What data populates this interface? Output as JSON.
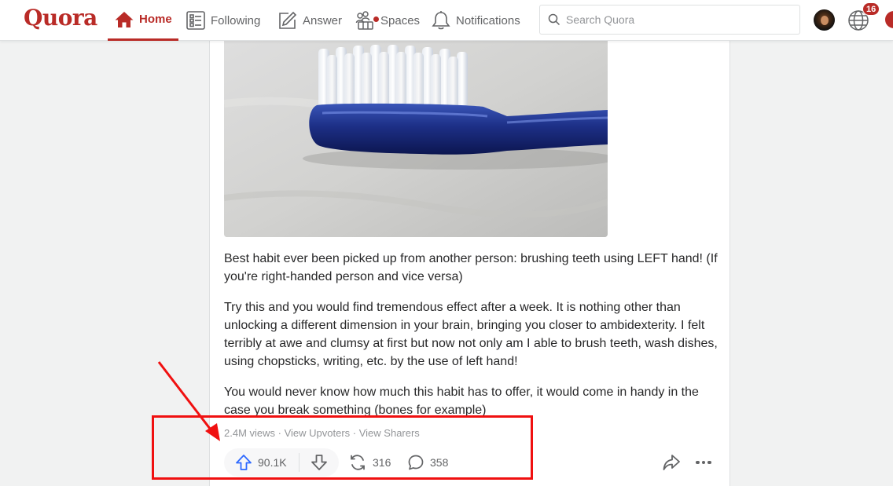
{
  "brand": {
    "logo_text": "Quora",
    "accent_color": "#b92b27"
  },
  "nav": {
    "home_label": "Home",
    "following_label": "Following",
    "answer_label": "Answer",
    "spaces_label": "Spaces",
    "notifications_label": "Notifications",
    "active": "home",
    "icons": [
      "home-icon",
      "following-icon",
      "answer-icon",
      "spaces-icon",
      "bell-icon"
    ]
  },
  "search": {
    "placeholder": "Search Quora",
    "value": ""
  },
  "user": {
    "notification_badge": "16"
  },
  "post": {
    "image_alt": "Blue toothbrush lying on a white cloth",
    "paragraphs": [
      "Best habit ever been picked up from another person: brushing teeth using LEFT hand! (If you're right-handed person and vice versa)",
      "Try this and you would find tremendous effect after a week. It is nothing other than unlocking a different dimension in your brain, bringing you closer to ambidexterity. I felt terribly at awe and clumsy at first but now not only am I able to brush teeth, wash dishes, using chopsticks, writing, etc. by the use of left hand!",
      "You would never know how much this habit has to offer, it would come in handy in the case you break something (bones for example)"
    ],
    "views": "2.4M views",
    "separator": " · ",
    "view_upvoters": "View Upvoters",
    "view_sharers": "View Sharers",
    "upvotes": "90.1K",
    "shares": "316",
    "comments": "358"
  },
  "annotation": {
    "color": "#f01010"
  }
}
